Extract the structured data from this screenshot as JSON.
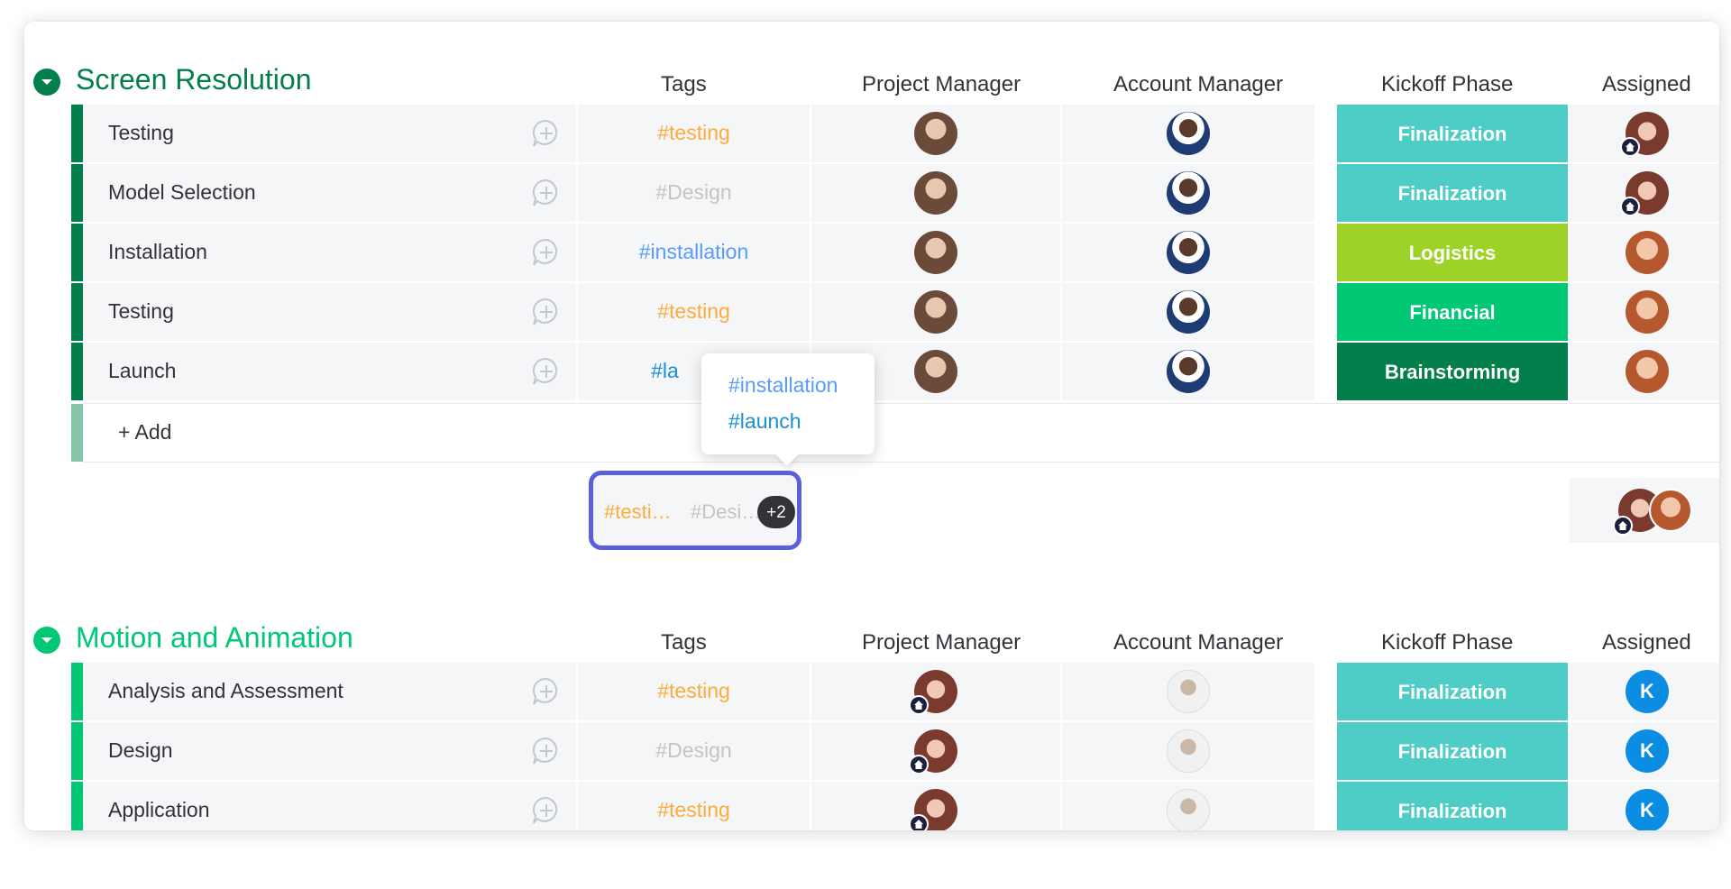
{
  "columns": [
    "Tags",
    "Project Manager",
    "Account Manager",
    "Kickoff Phase",
    "Assigned"
  ],
  "colors": {
    "group1": "#037f4c",
    "group2": "#00c875",
    "finalization": "#4eccc6",
    "logistics": "#9cd326",
    "financial": "#00c875",
    "brainstorming": "#037f4c",
    "tag_testing": "#fdab3d",
    "tag_design": "#c4c4c4",
    "tag_installation": "#579bfc",
    "tag_launch": "#1a8ed6",
    "focus_ring": "#5b5fdc"
  },
  "groups": [
    {
      "title": "Screen Resolution",
      "rows": [
        {
          "name": "Testing",
          "tag": "#testing",
          "phase": "Finalization"
        },
        {
          "name": "Model Selection",
          "tag": "#Design",
          "phase": "Finalization"
        },
        {
          "name": "Installation",
          "tag": "#installation",
          "phase": "Logistics"
        },
        {
          "name": "Testing",
          "tag": "#testing",
          "phase": "Financial"
        },
        {
          "name": "Launch",
          "tag": "#la",
          "phase": "Brainstorming"
        }
      ],
      "add_label": "+ Add",
      "summary": {
        "tag1": "#testi…",
        "tag2": "#Desi…",
        "more": "+2"
      }
    },
    {
      "title": "Motion and Animation",
      "rows": [
        {
          "name": "Analysis and Assessment",
          "tag": "#testing",
          "phase": "Finalization",
          "assigned": "K"
        },
        {
          "name": "Design",
          "tag": "#Design",
          "phase": "Finalization",
          "assigned": "K"
        },
        {
          "name": "Application",
          "tag": "#testing",
          "phase": "Finalization",
          "assigned": "K"
        }
      ]
    }
  ],
  "tag_popover": [
    "#installation",
    "#launch"
  ],
  "icons": {
    "group_toggle": "chevron-down-icon",
    "updates": "chat-plus-icon",
    "home_badge": "home-icon"
  }
}
